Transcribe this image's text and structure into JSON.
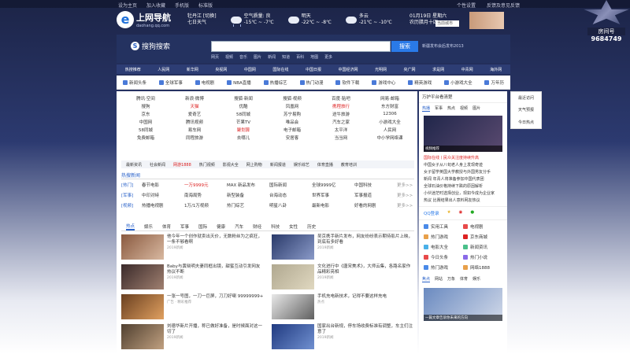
{
  "topbar": {
    "links": [
      "设为主页",
      "加入收藏",
      "手机版",
      "标准版"
    ],
    "right": [
      "个性设置",
      "反馈及意见反馈"
    ]
  },
  "header": {
    "logo_letter": "e",
    "logo_title": "上网导航",
    "logo_sub": "daohang.qq.com",
    "city": "牡丹江 [切换]",
    "forecast_label": "七日天气",
    "weather": [
      {
        "label": "空气质量: 良",
        "temp": "-15℃ ~ -7℃"
      },
      {
        "label": "明天",
        "temp": "-22℃ ~ -8℃"
      },
      {
        "label": "多云",
        "temp": "-21℃ ~ -10℃"
      }
    ],
    "date": "01月19日 星期六",
    "date_sub": "农历腊月十四",
    "city_select": "当前城市"
  },
  "search": {
    "brand_letter": "S",
    "brand": "搜狗搜索",
    "button": "搜索",
    "extra": "新疆发布会后发布2013",
    "tabs": [
      "网页",
      "视频",
      "音乐",
      "图片",
      "新闻",
      "知道",
      "百科",
      "地图",
      "更多"
    ]
  },
  "nav1": [
    "热搜推荐",
    "人民网",
    "新华网",
    "央视网",
    "中国网",
    "国际在线",
    "中国日报",
    "中国经济网",
    "光明网",
    "央广网",
    "求是网",
    "中青网",
    "海外网"
  ],
  "nav2": [
    "新闻头条",
    "全球军事",
    "电视剧",
    "NBA直播",
    "热播综艺",
    "热门动漫",
    "软件下载",
    "游戏中心",
    "精英游戏",
    "小游戏大全",
    "万年历"
  ],
  "sites": [
    [
      "腾讯·空间",
      "新浪·微博",
      "搜狐·新闻",
      "搜狐·视频",
      "百度·贴吧",
      "网易·邮箱"
    ],
    [
      "搜狗",
      "天猫",
      "优酷",
      "凤凰网",
      "携程旅行",
      "东方财富"
    ],
    [
      "京东",
      "爱奇艺",
      "58同城",
      "苏宁易购",
      "途牛旅游",
      "12306"
    ],
    [
      "中国网",
      "腾讯视频",
      "芒果TV",
      "唯品会",
      "汽车之家",
      "小游戏大全"
    ],
    [
      "58同城",
      "易车网",
      "聚划算",
      "电子邮箱",
      "太平洋",
      "人民网"
    ],
    [
      "免费邮箱",
      "同程旅游",
      "去哪儿",
      "安居客",
      "当当网",
      "中小学网络课"
    ]
  ],
  "catbar": [
    "最新资讯",
    "社会新闻",
    "网游1888",
    "热门视频",
    "影视大全",
    "网上购物",
    "新闻报道",
    "娱乐综艺",
    "体育直播",
    "教育培训"
  ],
  "hot": {
    "title": "热搜新闻",
    "rows": [
      {
        "tag": "[热门]",
        "items": [
          "春节电影",
          "一万9999元",
          "MAX 新品发布",
          "国际新闻",
          "全球9999亿",
          "中国科技"
        ],
        "more": "更多>>"
      },
      {
        "tag": "[军事]",
        "items": [
          "中印对峙",
          "南海局势",
          "新型装备",
          "台海动态",
          "世界军事",
          "军事报道"
        ],
        "more": "更多>>"
      },
      {
        "tag": "[视频]",
        "items": [
          "热播电视剧",
          "1万/1万视频",
          "热门综艺",
          "明星八卦",
          "最新电影",
          "好看的网剧"
        ],
        "more": "更多>>"
      }
    ]
  },
  "newstabs": [
    "热点",
    "娱乐",
    "体育",
    "军事",
    "国际",
    "健康",
    "汽车",
    "财经",
    "科技",
    "女性",
    "历史"
  ],
  "news": [
    {
      "title": "他今年一个创作就卖出天价，无数粉丝为之疯狂，一条不够看啊",
      "src": "2019新闻"
    },
    {
      "title": "吴京携手新片发布，网友纷纷表示期待影片上映，到底有多好看",
      "src": "2019新闻"
    },
    {
      "title": "Baby与黄晓明夫妻同框出镜，甜蜜互动引发网友热议不断",
      "src": "2019新闻"
    },
    {
      "title": "文化进行中《唐宋美术》，大师云集，各路名家作品精彩亮相",
      "src": "2019新闻"
    },
    {
      "title": "一张一号图，一刀一巨屏，刀刀好喇 99999999+",
      "src": "广告 · 精彩推荐"
    },
    {
      "title": "手机充电新技术，记得不要这样充电",
      "src": "热点"
    },
    {
      "title": "刘德华新片开播，称已做好准备，是时候面对这一切了",
      "src": "2019新闻"
    },
    {
      "title": "国家出台新规，停车场收费标准有调整，车主们注意了",
      "src": "2019新闻"
    }
  ],
  "side": {
    "header": "万护平台看清楚",
    "tabs": [
      "热播",
      "军事",
      "热点",
      "视频",
      "图片"
    ],
    "pic_caption": "视频推荐",
    "list": [
      {
        "text": "国际在线丨民众关注度持续升高",
        "hot": true
      },
      {
        "text": "中国女子从八旬老人身上发现奇迹",
        "hot": false
      },
      {
        "text": "女子留学英国大学教授与外国男友分手",
        "hot": false
      },
      {
        "text": "新闻 年青人将准备参加中国代表团",
        "hot": false
      },
      {
        "text": "全球石油价格持续下跌的原因解析",
        "hot": false
      },
      {
        "text": "小伙迷茫时选择创业，现如今成为企业家",
        "hot": false
      },
      {
        "text": "热议 比赛结果出人意料网友热议",
        "hot": false
      }
    ],
    "qq": "QQ登录",
    "tools": [
      "实用工具",
      "电视剧",
      "热门游戏",
      "京东商城",
      "电影大全",
      "新闻资讯",
      "今日头条",
      "热门小说",
      "热门游戏",
      "网络1888"
    ],
    "tabs2": [
      "焦点",
      "网站",
      "万象",
      "体育",
      "娱乐"
    ],
    "pic2_caption": "一篇文章告诉你未来的方向"
  },
  "floatbar": [
    "最近访问",
    "天气预报",
    "今日热点"
  ],
  "badge": {
    "label": "房间号",
    "number": "9684749"
  },
  "colors": {
    "accent": "#2a7ae8",
    "brand": "#1e6fd9",
    "header_bg": "#243260",
    "hot_red": "#dd2222"
  }
}
